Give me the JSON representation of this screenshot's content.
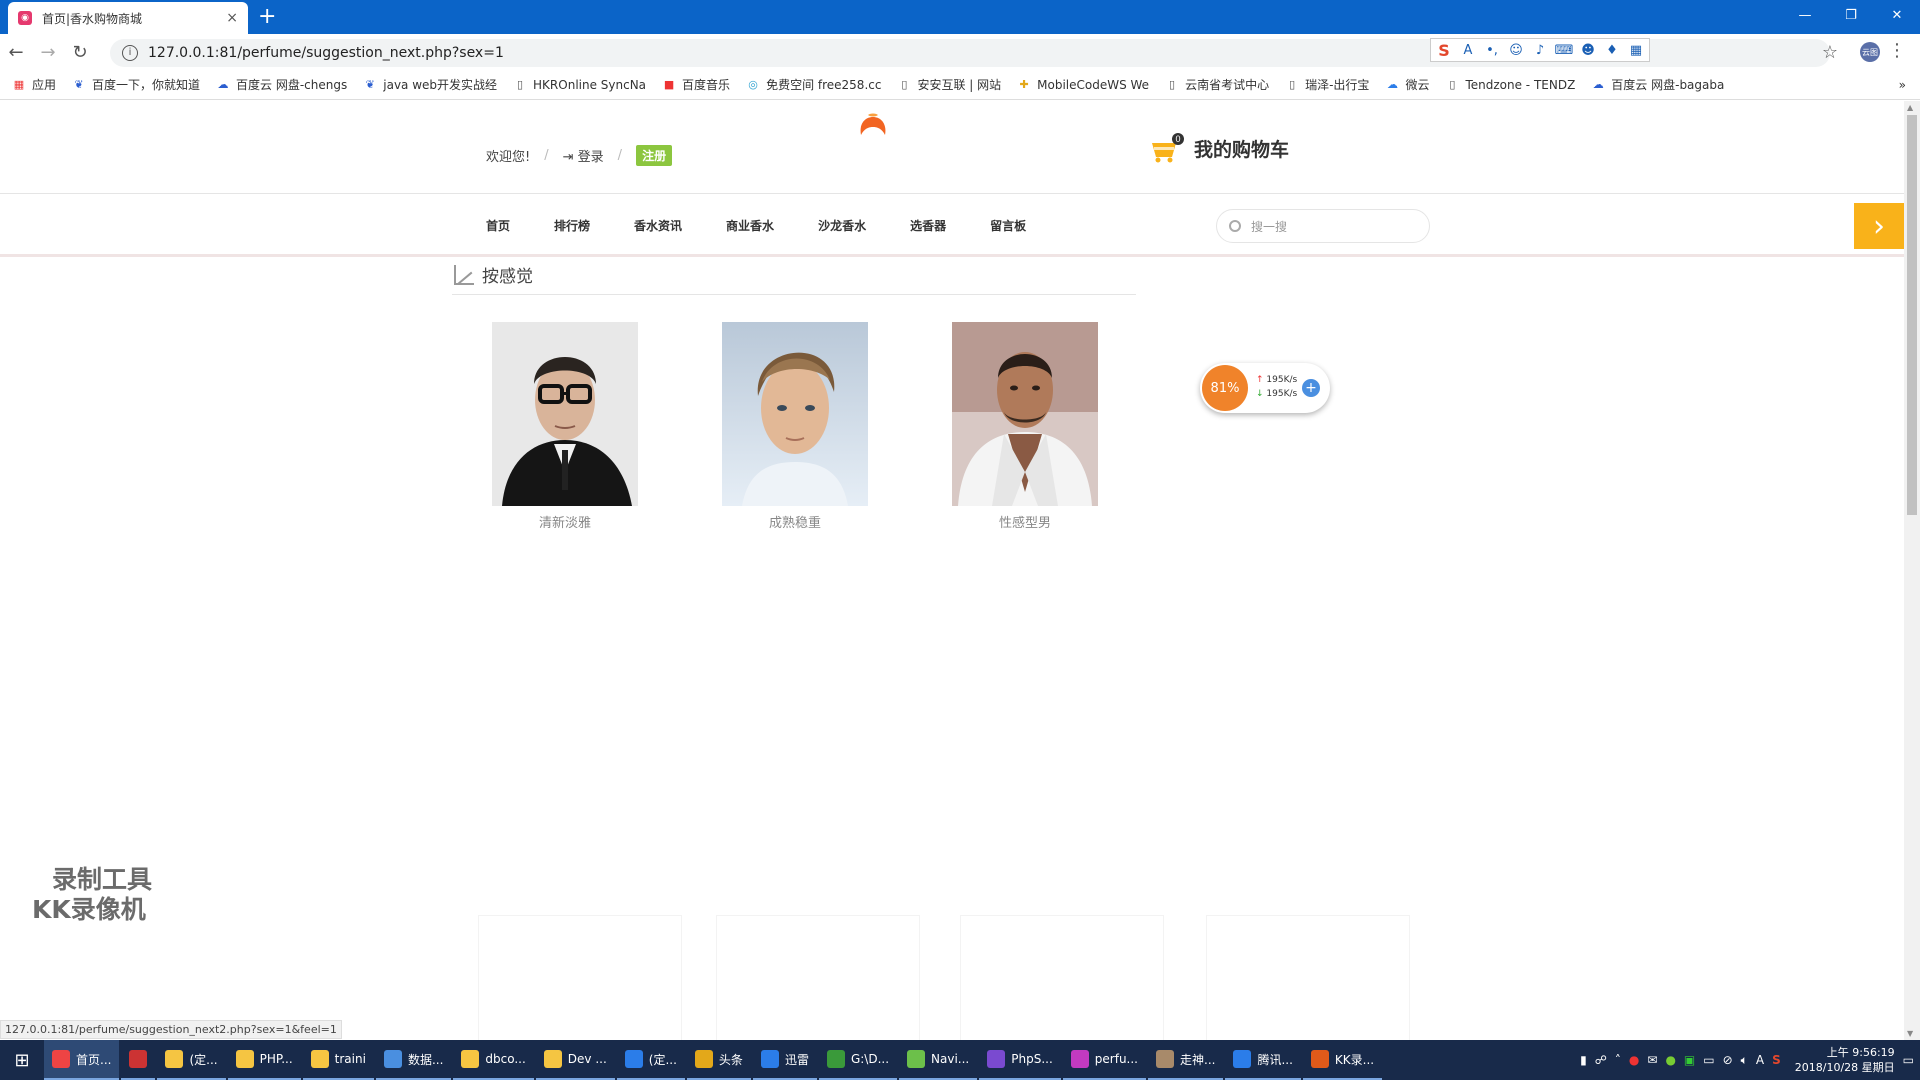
{
  "browser": {
    "tab_title": "首页|香水购物商城",
    "tab_close": "×",
    "new_tab": "+",
    "url": "127.0.0.1:81/perfume/suggestion_next.php?sex=1",
    "window_buttons": [
      "—",
      "❐",
      "✕"
    ],
    "bookmarks": [
      {
        "label": "应用",
        "icon": "apps-icon"
      },
      {
        "label": "百度一下，你就知道",
        "icon": "baidu-paw-icon"
      },
      {
        "label": "百度云 网盘-chengs",
        "icon": "baidu-cloud-icon"
      },
      {
        "label": "java web开发实战经",
        "icon": "baidu-paw-icon"
      },
      {
        "label": "HKROnline SyncNa",
        "icon": "page-icon"
      },
      {
        "label": "百度音乐",
        "icon": "baidu-music-icon"
      },
      {
        "label": "免费空间 free258.cc",
        "icon": "circle-icon"
      },
      {
        "label": "安安互联 | 网站",
        "icon": "page-icon"
      },
      {
        "label": "MobileCodeWS We",
        "icon": "puzzle-icon"
      },
      {
        "label": "云南省考试中心",
        "icon": "page-icon"
      },
      {
        "label": "瑞泽-出行宝",
        "icon": "page-icon"
      },
      {
        "label": "微云",
        "icon": "weiyun-icon"
      },
      {
        "label": "Tendzone - TENDZ",
        "icon": "page-icon"
      },
      {
        "label": "百度云 网盘-bagaba",
        "icon": "baidu-cloud-icon"
      }
    ],
    "bookmarks_more": "»",
    "avatar_text": "云图",
    "status_url": "127.0.0.1:81/perfume/suggestion_next2.php?sex=1&feel=1"
  },
  "header": {
    "welcome": "欢迎您!",
    "sep": "/",
    "login": "登录",
    "register": "注册",
    "cart_label": "我的购物车",
    "cart_count": "0"
  },
  "nav": {
    "items": [
      "首页",
      "排行榜",
      "香水资讯",
      "商业香水",
      "沙龙香水",
      "选香器",
      "留言板"
    ],
    "search_placeholder": "搜一搜",
    "next_arrow": "›"
  },
  "section": {
    "title": "按感觉"
  },
  "cards": [
    {
      "caption": "清新淡雅"
    },
    {
      "caption": "成熟稳重"
    },
    {
      "caption": "性感型男"
    }
  ],
  "net_widget": {
    "percent": "81%",
    "up_speed": "195K/s",
    "down_speed": "195K/s",
    "plus": "+"
  },
  "watermark": {
    "line1": "录制工具",
    "line2": "KK录像机"
  },
  "taskbar": {
    "tasks": [
      {
        "label": "首页...",
        "color": "#e44",
        "active": true
      },
      {
        "label": "",
        "color": "#c33",
        "active": false
      },
      {
        "label": "(定...",
        "color": "#f5c542",
        "active": false
      },
      {
        "label": "PHP...",
        "color": "#f5c542",
        "active": false
      },
      {
        "label": "traini",
        "color": "#f5c542",
        "active": false
      },
      {
        "label": "数据...",
        "color": "#4a8fe0",
        "active": false
      },
      {
        "label": "dbco...",
        "color": "#f5c542",
        "active": false
      },
      {
        "label": "Dev ...",
        "color": "#f5c542",
        "active": false
      },
      {
        "label": "(定...",
        "color": "#2b7de9",
        "active": false
      },
      {
        "label": "头条",
        "color": "#e3a81a",
        "active": false
      },
      {
        "label": "迅雷",
        "color": "#2b7de9",
        "active": false
      },
      {
        "label": "G:\\D...",
        "color": "#3a9a3a",
        "active": false
      },
      {
        "label": "Navi...",
        "color": "#6cc04a",
        "active": false
      },
      {
        "label": "PhpS...",
        "color": "#7a4ad0",
        "active": false
      },
      {
        "label": "perfu...",
        "color": "#c33ac0",
        "active": false
      },
      {
        "label": "走神...",
        "color": "#a88a6a",
        "active": false
      },
      {
        "label": "腾讯...",
        "color": "#2b7de9",
        "active": false
      },
      {
        "label": "KK录...",
        "color": "#e05a1a",
        "active": false
      }
    ],
    "time": "上午 9:56:19",
    "date": "2018/10/28 星期日"
  }
}
